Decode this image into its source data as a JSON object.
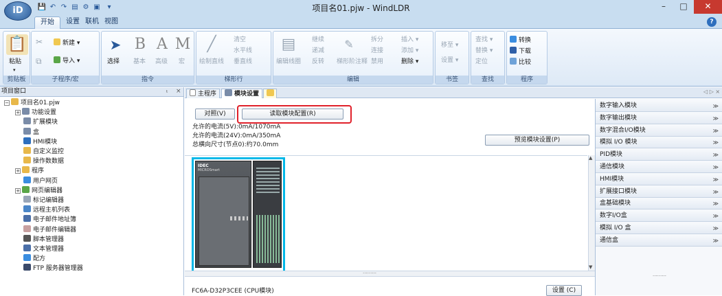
{
  "window": {
    "title": "项目名01.pjw - WindLDR",
    "app_button": "iD",
    "min": "–",
    "max": "□",
    "close": "✕",
    "help": "?"
  },
  "qat": [
    "💾",
    "↶",
    "↷",
    "▤",
    "⚙",
    "▣",
    "▾"
  ],
  "ribbon_tabs": [
    "开始",
    "设置",
    "联机",
    "视图"
  ],
  "ribbon": {
    "clipboard": {
      "label": "剪贴板",
      "paste": "粘贴",
      "paste_arrow": "▾"
    },
    "program": {
      "label": "子程序/宏",
      "new": "新建 ▾",
      "import": "导入 ▾"
    },
    "instruction": {
      "label": "指令",
      "select": "选择",
      "basic": "基本",
      "advanced": "高级",
      "macro": "宏"
    },
    "ladder": {
      "label": "梯形行",
      "draw_line": "绘制直线",
      "clear": "清空",
      "hline": "水平线",
      "vline": "垂直线"
    },
    "edit": {
      "label": "编辑",
      "edit_line": "编辑线圈",
      "cont": "继续",
      "reduce": "递减",
      "reverse": "反转",
      "comment": "梯形阶注释",
      "split": "拆分",
      "link": "连接",
      "disable": "禁用",
      "insert": "插入 ▾",
      "add": "添加 ▾",
      "delete": "删除 ▾"
    },
    "bookmark": {
      "label": "书签",
      "move": "移至 ▾",
      "set": "设置 ▾"
    },
    "find": {
      "label": "查找",
      "find": "查找 ▾",
      "replace": "替换 ▾",
      "locate": "定位"
    },
    "prog": {
      "label": "程序",
      "convert": "转换",
      "download": "下载",
      "compare": "比较"
    }
  },
  "left_pane": {
    "title": "项目窗口",
    "pin": "ₜ",
    "close": "×",
    "tree": [
      {
        "label": "项目名01.pjw",
        "level": 0,
        "exp": "−",
        "color": "#e8b84a"
      },
      {
        "label": "功能设置",
        "level": 1,
        "exp": "+",
        "color": "#7a8ca8"
      },
      {
        "label": "扩展模块",
        "level": 1,
        "exp": "",
        "color": "#7a8ca8"
      },
      {
        "label": "盒",
        "level": 1,
        "exp": "",
        "color": "#7a8ca8"
      },
      {
        "label": "HMI模块",
        "level": 1,
        "exp": "",
        "color": "#2e6fbd"
      },
      {
        "label": "自定义监控",
        "level": 1,
        "exp": "",
        "color": "#e8b84a"
      },
      {
        "label": "操作数数据",
        "level": 1,
        "exp": "",
        "color": "#e8b84a"
      },
      {
        "label": "程序",
        "level": 1,
        "exp": "+",
        "color": "#e8b84a"
      },
      {
        "label": "用户网页",
        "level": 1,
        "exp": "",
        "color": "#3a8de0"
      },
      {
        "label": "网页编辑器",
        "level": 1,
        "exp": "+",
        "color": "#5aa648"
      },
      {
        "label": "标记编辑器",
        "level": 1,
        "exp": "",
        "color": "#9aa6b8"
      },
      {
        "label": "远程主机列表",
        "level": 1,
        "exp": "",
        "color": "#4b86c8"
      },
      {
        "label": "电子邮件地址簿",
        "level": 1,
        "exp": "",
        "color": "#4b6fa8"
      },
      {
        "label": "电子邮件编辑器",
        "level": 1,
        "exp": "",
        "color": "#c8a0a0"
      },
      {
        "label": "脚本管理器",
        "level": 1,
        "exp": "",
        "color": "#555"
      },
      {
        "label": "文本管理器",
        "level": 1,
        "exp": "",
        "color": "#4b6fa8"
      },
      {
        "label": "配方",
        "level": 1,
        "exp": "",
        "color": "#3a8de0"
      },
      {
        "label": "FTP 服务器管理器",
        "level": 1,
        "exp": "",
        "color": "#3a4a6a"
      }
    ]
  },
  "doc_tabs": [
    "主程序",
    "模块设置",
    ""
  ],
  "doc_nav": "◁ ▷ ×",
  "module": {
    "ref_btn": "对照(V)",
    "read_btn": "读取模块配置(R)",
    "current_5v": "允许的电流(5V):0mA/1070mA",
    "current_24v": "允许的电流(24V):0mA/350mA",
    "size": "总横向尺寸(节点0):约70.0mm",
    "preview_btn": "预览模块设置(P)",
    "cpu_name": "FC6A-D32P3CEE (CPU模块)",
    "settings_btn": "设置 (C)",
    "plc_brand": "IDEC",
    "plc_model": "MICROSmart",
    "scroll_dots": "........."
  },
  "right_pane": {
    "categories": [
      "数字输入模块",
      "数字输出模块",
      "数字混合I/O模块",
      "模拟 I/O 模块",
      "PID模块",
      "通信模块",
      "HMI模块",
      "扩展接口模块",
      "盒基础模块",
      "数字I/O盒",
      "模拟 I/O 盒",
      "通信盒"
    ],
    "chev": "≫",
    "dots": "........."
  },
  "colors": {
    "highlight": "#e0202a",
    "selection": "#00b8e8"
  }
}
